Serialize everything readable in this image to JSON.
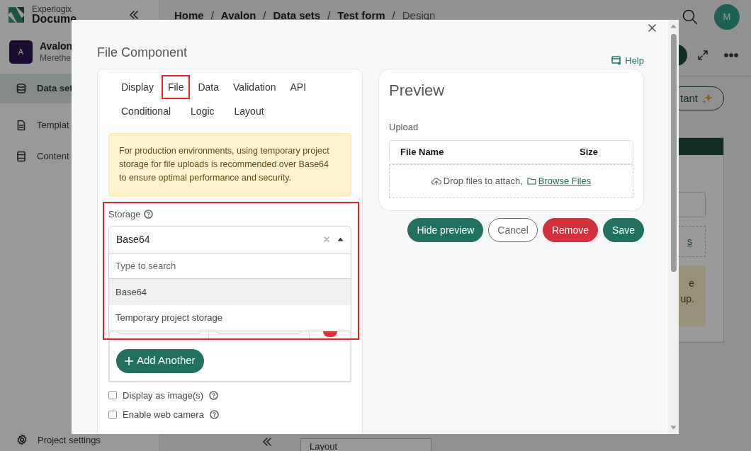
{
  "background": {
    "logo": {
      "line1": "Experlogix",
      "line2": "Docume"
    },
    "project": {
      "initial": "A",
      "name": "Avalon",
      "owner": "Merethe"
    },
    "nav": [
      {
        "label": "Data set",
        "selected": true
      },
      {
        "label": "Templat",
        "selected": false
      },
      {
        "label": "Content",
        "selected": false
      }
    ],
    "footer_link": "Project settings",
    "breadcrumb": [
      {
        "kind": "link",
        "label": "Home"
      },
      {
        "kind": "separator",
        "label": "/"
      },
      {
        "kind": "link",
        "label": "Avalon"
      },
      {
        "kind": "separator",
        "label": "/"
      },
      {
        "kind": "link",
        "label": "Data sets"
      },
      {
        "kind": "separator",
        "label": "/"
      },
      {
        "kind": "link",
        "label": "Test form"
      },
      {
        "kind": "separator",
        "label": "/"
      },
      {
        "kind": "current",
        "label": "Design"
      }
    ],
    "user_initial": "M",
    "assistant_button": "tant",
    "link_fragment": "s",
    "note_lines": [
      "e",
      "up."
    ],
    "layout_select": "Layout"
  },
  "modal": {
    "title": "File Component",
    "help": "Help",
    "tabs": [
      {
        "label": "Display",
        "selected": false
      },
      {
        "label": "File",
        "selected": true
      },
      {
        "label": "Data",
        "selected": false
      },
      {
        "label": "Validation",
        "selected": false
      },
      {
        "label": "API",
        "selected": false
      },
      {
        "label": "Conditional",
        "selected": false
      },
      {
        "label": "Logic",
        "selected": false
      },
      {
        "label": "Layout",
        "selected": false
      }
    ],
    "warning": "For production environments, using temporary project storage for file uploads is recommended over Base64 to ensure optimal performance and security.",
    "storage": {
      "label": "Storage",
      "value": "Base64",
      "expanded": true,
      "search_placeholder": "Type to search",
      "options": [
        {
          "label": "Base64",
          "selected": true
        },
        {
          "label": "Temporary project storage",
          "selected": false
        }
      ]
    },
    "add_button": "Add Another",
    "checkboxes": [
      {
        "label": "Display as image(s)",
        "checked": false
      },
      {
        "label": "Enable web camera",
        "checked": false
      }
    ],
    "preview": {
      "title": "Preview",
      "upload_label": "Upload",
      "columns": [
        "File Name",
        "Size"
      ],
      "drop_text": "Drop files to attach,",
      "browse_link": "Browse Files"
    },
    "buttons": [
      {
        "label": "Hide preview",
        "kind": "primary"
      },
      {
        "label": "Cancel",
        "kind": "outline"
      },
      {
        "label": "Remove",
        "kind": "danger"
      },
      {
        "label": "Save",
        "kind": "primary"
      }
    ]
  }
}
